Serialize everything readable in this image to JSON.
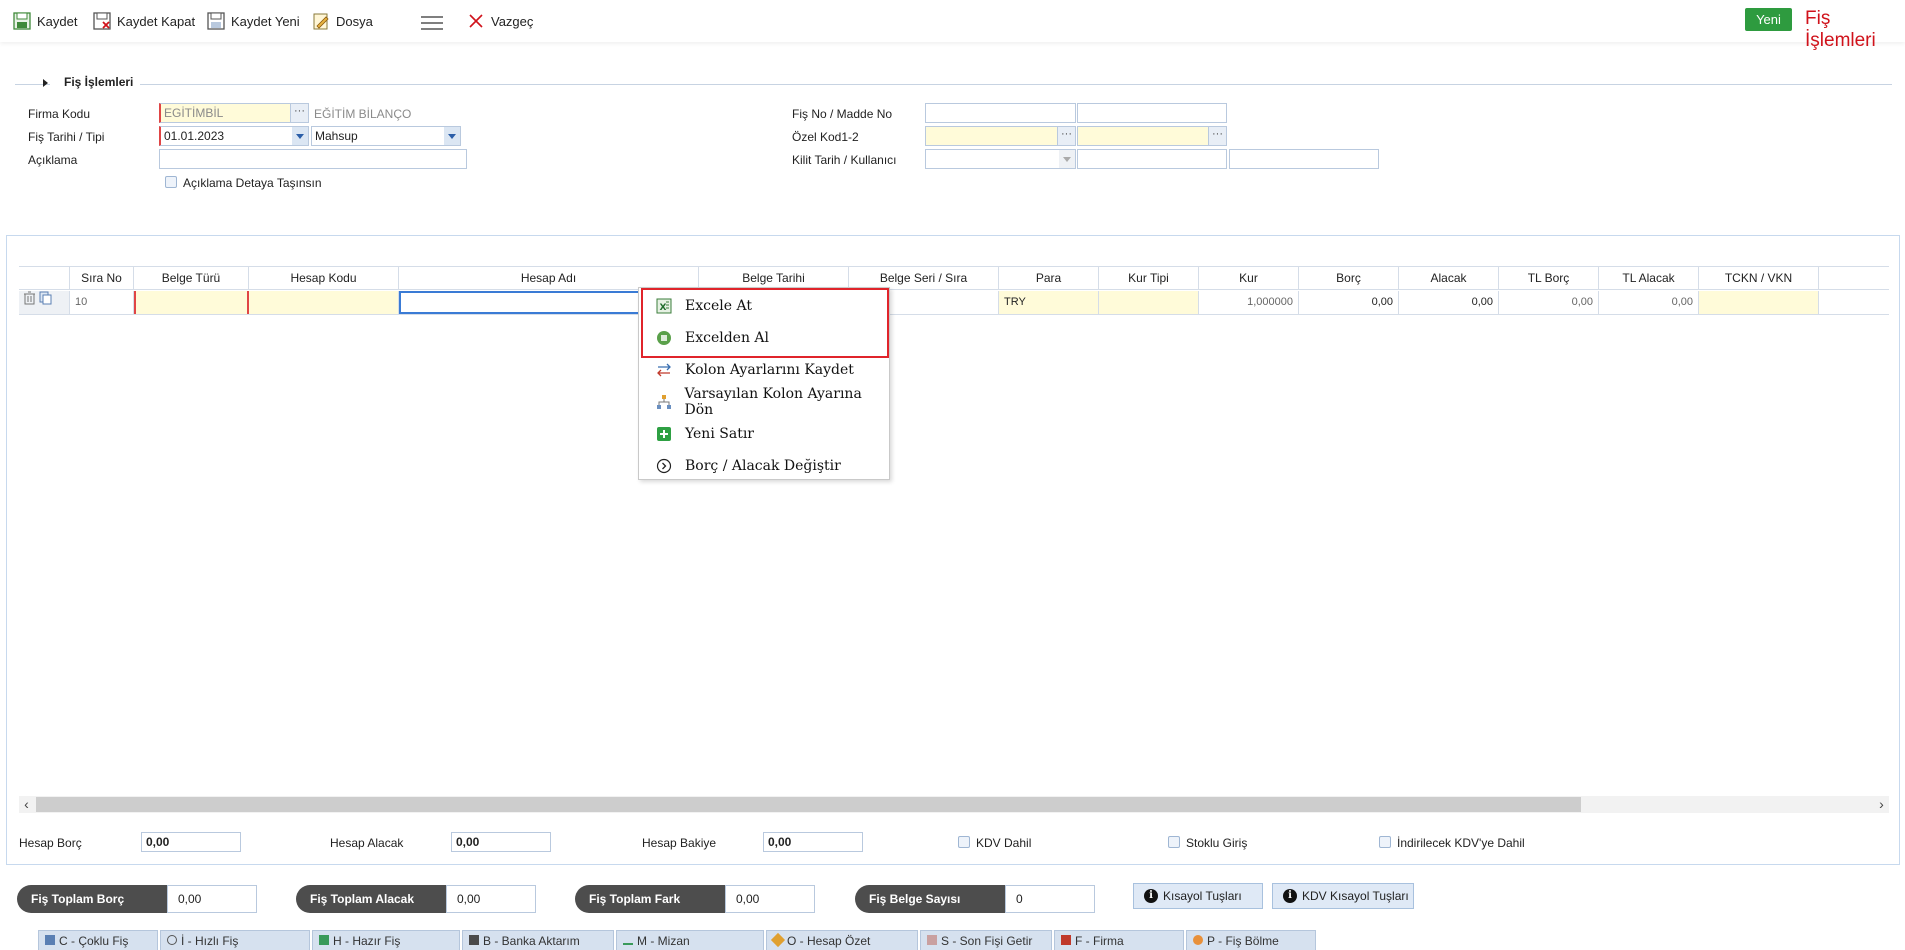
{
  "toolbar": {
    "save": "Kaydet",
    "save_close": "Kaydet Kapat",
    "save_new": "Kaydet Yeni",
    "file": "Dosya",
    "cancel": "Vazgeç",
    "new_badge": "Yeni",
    "page_title": "Fiş İşlemleri"
  },
  "fieldset": {
    "title": "Fiş İşlemleri"
  },
  "form": {
    "company_code_label": "Firma Kodu",
    "company_code_value": "EGİTİMBİL",
    "company_name": "EĞİTİM BİLANÇO",
    "date_type_label": "Fiş Tarihi / Tipi",
    "date_value": "01.01.2023",
    "type_value": "Mahsup",
    "description_label": "Açıklama",
    "description_value": "",
    "carry_desc_label": "Açıklama Detaya Taşınsın",
    "slip_no_label": "Fiş No / Madde No",
    "special_code_label": "Özel Kod1-2",
    "lock_label": "Kilit Tarih / Kullanıcı"
  },
  "grid": {
    "columns": [
      "Sıra No",
      "Belge Türü",
      "Hesap Kodu",
      "Hesap Adı",
      "Belge Tarihi",
      "Belge Seri / Sıra",
      "Para",
      "Kur Tipi",
      "Kur",
      "Borç",
      "Alacak",
      "TL Borç",
      "TL Alacak",
      "TCKN / VKN"
    ],
    "rows": [
      {
        "sira_no": "10",
        "belge_turu": "",
        "hesap_kodu": "",
        "hesap_adi": "",
        "belge_tarihi": "",
        "belge_seri": "",
        "para": "TRY",
        "kur_tipi": "",
        "kur": "1,000000",
        "borc": "0,00",
        "alacak": "0,00",
        "tl_borc": "0,00",
        "tl_alacak": "0,00",
        "tckn": ""
      }
    ]
  },
  "context_menu": {
    "items": [
      "Excele At",
      "Excelden Al",
      "Kolon Ayarlarını Kaydet",
      "Varsayılan Kolon Ayarına Dön",
      "Yeni Satır",
      "Borç / Alacak Değiştir"
    ]
  },
  "summary": {
    "hesap_borc_label": "Hesap Borç",
    "hesap_borc_value": "0,00",
    "hesap_alacak_label": "Hesap Alacak",
    "hesap_alacak_value": "0,00",
    "hesap_bakiye_label": "Hesap Bakiye",
    "hesap_bakiye_value": "0,00",
    "kdv_dahil": "KDV Dahil",
    "stoklu_giris": "Stoklu Giriş",
    "indirilecek_kdv": "İndirilecek KDV'ye Dahil"
  },
  "totals": {
    "toplam_borc_label": "Fiş Toplam Borç",
    "toplam_borc_value": "0,00",
    "toplam_alacak_label": "Fiş Toplam Alacak",
    "toplam_alacak_value": "0,00",
    "toplam_fark_label": "Fiş Toplam Fark",
    "toplam_fark_value": "0,00",
    "belge_sayisi_label": "Fiş Belge Sayısı",
    "belge_sayisi_value": "0",
    "kisayol": "Kısayol Tuşları",
    "kdv_kisayol": "KDV Kısayol Tuşları"
  },
  "bottom_tabs": [
    "C - Çoklu Fiş",
    "İ - Hızlı Fiş",
    "H - Hazır Fiş",
    "B - Banka Aktarım",
    "M - Mizan",
    "O - Hesap Özet",
    "S - Son Fişi Getir",
    "F - Firma",
    "P - Fiş Bölme"
  ],
  "colors": {
    "accent_red": "#d0121b",
    "new_green": "#2e9b3f",
    "required_field_bg": "#fffbd9",
    "highlight_border": "#e0242b"
  }
}
